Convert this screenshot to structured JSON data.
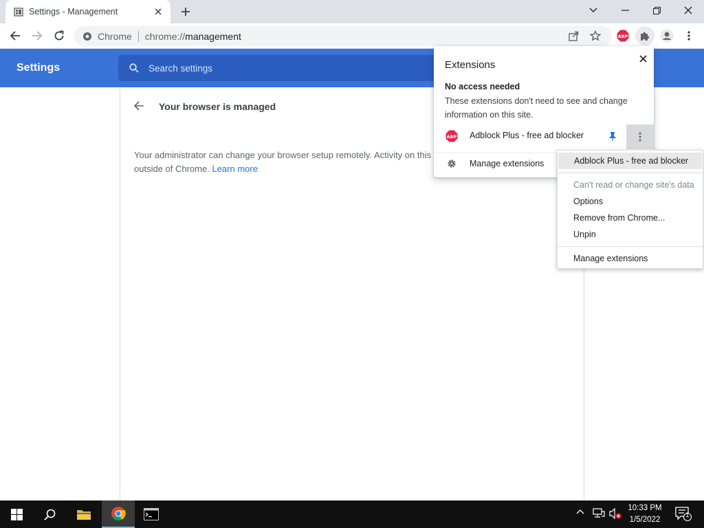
{
  "browser": {
    "tab_title": "Settings - Management",
    "url_site_label": "Chrome",
    "url_prefix": "chrome://",
    "url_path": "management"
  },
  "settings": {
    "header_title": "Settings",
    "search_placeholder": "Search settings",
    "page_title": "Your browser is managed",
    "admin_text": "Your administrator can change your browser setup remotely. Activity on this",
    "admin_text_2": "outside of Chrome.",
    "learn_more": "Learn more"
  },
  "extensions_popup": {
    "title": "Extensions",
    "section_title": "No access needed",
    "section_desc": "These extensions don't need to see and change information on this site.",
    "item_name": "Adblock Plus - free ad blocker",
    "manage_label": "Manage extensions"
  },
  "context_menu": {
    "header": "Adblock Plus - free ad blocker",
    "site_access": "Can't read or change site's data",
    "options": "Options",
    "remove": "Remove from Chrome...",
    "unpin": "Unpin",
    "manage": "Manage extensions"
  },
  "taskbar": {
    "time": "10:33 PM",
    "date": "1/5/2022",
    "notification_count": "1"
  },
  "colors": {
    "settings_blue": "#3a73d8",
    "abp_red": "#e2284b",
    "pin_blue": "#1a73e8"
  }
}
